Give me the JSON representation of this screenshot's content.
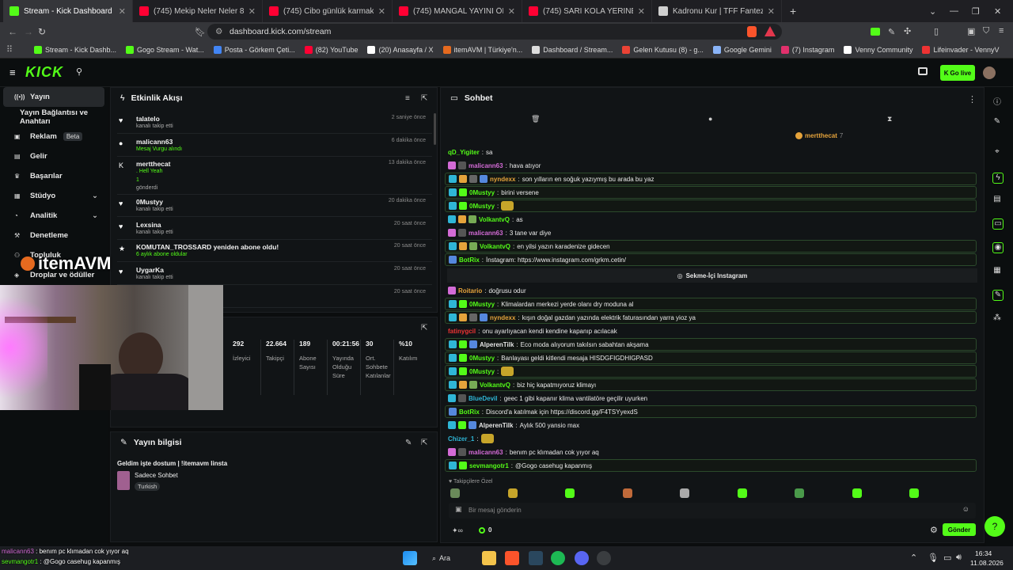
{
  "tabs": [
    {
      "label": "Stream - Kick Dashboard",
      "color": "#53fc18"
    },
    {
      "label": "(745) Mekip Neler Neler 84.Bölüm C",
      "color": "#ff0033"
    },
    {
      "label": "(745) Cibo günlük karmakarışık #2 -",
      "color": "#ff0033"
    },
    {
      "label": "(745) MANGAL YAYINI ÖNCESİ MEK",
      "color": "#ff0033"
    },
    {
      "label": "(745) SARI KOLA YERİNE PAPATYA Ç",
      "color": "#ff0033"
    },
    {
      "label": "Kadronu Kur | TFF Fantezi Lig",
      "color": "#cfcfcf"
    }
  ],
  "url": "dashboard.kick.com/stream",
  "bookmarks": [
    {
      "label": "Stream - Kick Dashb...",
      "color": "#53fc18"
    },
    {
      "label": "Gogo Stream - Wat...",
      "color": "#53fc18"
    },
    {
      "label": "Posta - Görkem Çeti...",
      "color": "#4285f4"
    },
    {
      "label": "(82) YouTube",
      "color": "#ff0033"
    },
    {
      "label": "(20) Anasayfa / X",
      "color": "#ffffff"
    },
    {
      "label": "itemAVM | Türkiye'n...",
      "color": "#e56a1f"
    },
    {
      "label": "Dashboard / Stream...",
      "color": "#dddddd"
    },
    {
      "label": "Gelen Kutusu (8) - g...",
      "color": "#ea4335"
    },
    {
      "label": "Google Gemini",
      "color": "#8ab4f8"
    },
    {
      "label": "(7) Instagram",
      "color": "#e1306c"
    },
    {
      "label": "Venny Community",
      "color": "#ffffff"
    },
    {
      "label": "Lifeinvader - VennyV",
      "color": "#e33"
    }
  ],
  "header": {
    "logo": "KICK",
    "go_live": "Go live"
  },
  "sidebar": [
    {
      "label": "Yayın",
      "icon": "broadcast-icon"
    },
    {
      "label": "Yayın Bağlantısı ve Anahtarı",
      "icon": ""
    },
    {
      "label": "Reklam",
      "icon": "ad-icon",
      "badge": "Beta"
    },
    {
      "label": "Gelir",
      "icon": "money-icon"
    },
    {
      "label": "Başarılar",
      "icon": "trophy-icon"
    },
    {
      "label": "Stüdyo",
      "icon": "studio-icon"
    },
    {
      "label": "Analitik",
      "icon": "chart-icon"
    },
    {
      "label": "Denetleme",
      "icon": "hammer-icon"
    },
    {
      "label": "Topluluk",
      "icon": "people-icon"
    },
    {
      "label": "Droplar ve ödüller",
      "icon": "gift-icon"
    }
  ],
  "activity": {
    "title": "Etkinlik Akışı",
    "events": [
      {
        "name": "talatelo",
        "detail": "kanalı takip etti",
        "time": "2 saniye önce",
        "icon": "♥"
      },
      {
        "name": "malicann63",
        "detail": "Mesaj Vurgu alındı",
        "time": "6 dakika önce",
        "icon": "●"
      },
      {
        "name": "mertthecat",
        "detail": ". Hell Yeah",
        "detail2": "1",
        "detail3": "gönderdi",
        "time": "13 dakika önce",
        "icon": "K"
      },
      {
        "name": "0Mustyy",
        "detail": "kanalı takip etti",
        "time": "20 dakika önce",
        "icon": "♥"
      },
      {
        "name": "Lexsina",
        "detail": "kanalı takip etti",
        "time": "20 saat önce",
        "icon": "♥"
      },
      {
        "name": "KOMUTAN_TROSSARD yeniden abone oldu!",
        "detail": "6 aylık abone oldular",
        "time": "20 saat önce",
        "icon": "★"
      },
      {
        "name": "UygarKa",
        "detail": "kanalı takip etti",
        "time": "20 saat önce",
        "icon": "♥"
      },
      {
        "name": "",
        "detail": "",
        "time": "20 saat önce",
        "icon": ""
      }
    ]
  },
  "stats": [
    {
      "value": "292",
      "label": "İzleyici"
    },
    {
      "value": "22.664",
      "label": "Takipçi"
    },
    {
      "value": "189",
      "label": "Abone Sayısı"
    },
    {
      "value": "00:21:56",
      "label": "Yayında Olduğu Süre"
    },
    {
      "value": "30",
      "label": "Ort. Sohbete Katılanlar"
    },
    {
      "value": "%10",
      "label": "Katılım"
    }
  ],
  "overlay_logo": "itemAVM",
  "info": {
    "title": "Yayın bilgisi",
    "stream_title": "Geldim işte dostum | !itemavm linsta",
    "category": "Sadece Sohbet",
    "tag": "Turkish"
  },
  "chat": {
    "title": "Sohbet",
    "pinned_user": "mertthecat",
    "pinned_count": "7",
    "messages": [
      {
        "user": "qD_Yigiter",
        "color": "#53fc18",
        "text": "sa",
        "badges": [],
        "hl": false
      },
      {
        "user": "malicann63",
        "color": "#d36bd6",
        "text": "hava atıyor",
        "badges": [
          "#d36bd6",
          "#555"
        ],
        "hl": false
      },
      {
        "user": "nyndexx",
        "color": "#e5a33b",
        "text": "son yılların en soğuk yazıymış bu arada bu yaz",
        "badges": [
          "#2fb6d6",
          "#e5a33b",
          "#666",
          "#5588dd"
        ],
        "hl": true
      },
      {
        "user": "0Mustyy",
        "color": "#53fc18",
        "text": "birini versene",
        "badges": [
          "#2fb6d6",
          "#53fc18"
        ],
        "hl": true
      },
      {
        "user": "0Mustyy",
        "color": "#53fc18",
        "text": "",
        "badges": [
          "#2fb6d6",
          "#53fc18"
        ],
        "hl": true
      },
      {
        "user": "VolkantvQ",
        "color": "#53fc18",
        "text": "as",
        "badges": [
          "#2fb6d6",
          "#e5a33b",
          "#7a5"
        ],
        "hl": false
      },
      {
        "user": "malicann63",
        "color": "#d36bd6",
        "text": "3 tane var diye",
        "badges": [
          "#d36bd6",
          "#555"
        ],
        "hl": false
      },
      {
        "user": "VolkantvQ",
        "color": "#53fc18",
        "text": "en yilsi yazın karadenize gidecen",
        "badges": [
          "#2fb6d6",
          "#e5a33b",
          "#7a5"
        ],
        "hl": true
      },
      {
        "user": "BotRix",
        "color": "#53fc18",
        "text": "İnstagram: https://www.instagram.com/grkm.cetin/",
        "badges": [
          "#5588dd"
        ],
        "hl": true
      },
      {
        "user": "Roitario",
        "color": "#e5a33b",
        "text": "doğrusu odur",
        "badges": [
          "#d36bd6"
        ],
        "hl": false
      },
      {
        "user": "0Mustyy",
        "color": "#53fc18",
        "text": "Klimalardan merkezi yerde olanı dry moduna al",
        "badges": [
          "#2fb6d6",
          "#53fc18"
        ],
        "hl": true
      },
      {
        "user": "nyndexx",
        "color": "#e5a33b",
        "text": "kışın doğal gazdan yazında elektrik faturasından yarra yioz ya",
        "badges": [
          "#2fb6d6",
          "#e5a33b",
          "#666",
          "#5588dd"
        ],
        "hl": true
      },
      {
        "user": "fatinygcil",
        "color": "#e33",
        "text": "onu ayarlıyacan kendi kendine kapanıp acılacak",
        "badges": [],
        "hl": false
      },
      {
        "user": "AlperenTilk",
        "color": "#e6e6e6",
        "text": "Eco moda alıyorum takılsın sabahtan akşama",
        "badges": [
          "#2fb6d6",
          "#53fc18",
          "#5588dd"
        ],
        "hl": true
      },
      {
        "user": "0Mustyy",
        "color": "#53fc18",
        "text": "Banlayası geldi kitlendi mesaja HISDGFIGDHIGPASD",
        "badges": [
          "#2fb6d6",
          "#53fc18"
        ],
        "hl": true
      },
      {
        "user": "0Mustyy",
        "color": "#53fc18",
        "text": "",
        "badges": [
          "#2fb6d6",
          "#53fc18"
        ],
        "hl": true
      },
      {
        "user": "VolkantvQ",
        "color": "#53fc18",
        "text": "biz hiç kapatmıyoruz klimayı",
        "badges": [
          "#2fb6d6",
          "#e5a33b",
          "#7a5"
        ],
        "hl": true
      },
      {
        "user": "BlueDevil",
        "color": "#2fb6d6",
        "text": "geec 1 gibi kapanır klima vantilatöre geçilir uyurken",
        "badges": [
          "#2fb6d6",
          "#555"
        ],
        "hl": false
      },
      {
        "user": "BotRix",
        "color": "#53fc18",
        "text": "Discord'a katılmak için https://discord.gg/F4TSYyexdS",
        "badges": [
          "#5588dd"
        ],
        "hl": true
      },
      {
        "user": "AlperenTilk",
        "color": "#e6e6e6",
        "text": "Aylık 500 yansio max",
        "badges": [
          "#2fb6d6",
          "#53fc18",
          "#5588dd"
        ],
        "hl": false
      },
      {
        "user": "Chizer_1",
        "color": "#2fb6d6",
        "text": "",
        "badges": [],
        "hl": false
      },
      {
        "user": "malicann63",
        "color": "#d36bd6",
        "text": "benım pc klımadan cok yıyor aq",
        "badges": [
          "#d36bd6",
          "#555"
        ],
        "hl": false
      },
      {
        "user": "sevmangotr1",
        "color": "#53fc18",
        "text": "@Gogo casehug kapanmış",
        "badges": [
          "#2fb6d6",
          "#53fc18"
        ],
        "hl": true
      }
    ],
    "tab_button": "Sekme-İçi Instagram",
    "followers_only": "Takipçilere Özel",
    "placeholder": "Bir mesaj gönderin",
    "send": "Gönder",
    "points": "0"
  },
  "taskbar": {
    "search": "Ara",
    "time": "16:34",
    "date": "11.08.2026",
    "toast": [
      {
        "user": "malicann63",
        "text": "benım pc klımadan cok yıyor aq"
      },
      {
        "user": "sevmangotr1",
        "text": "@Gogo casehug kapanmış"
      }
    ]
  }
}
